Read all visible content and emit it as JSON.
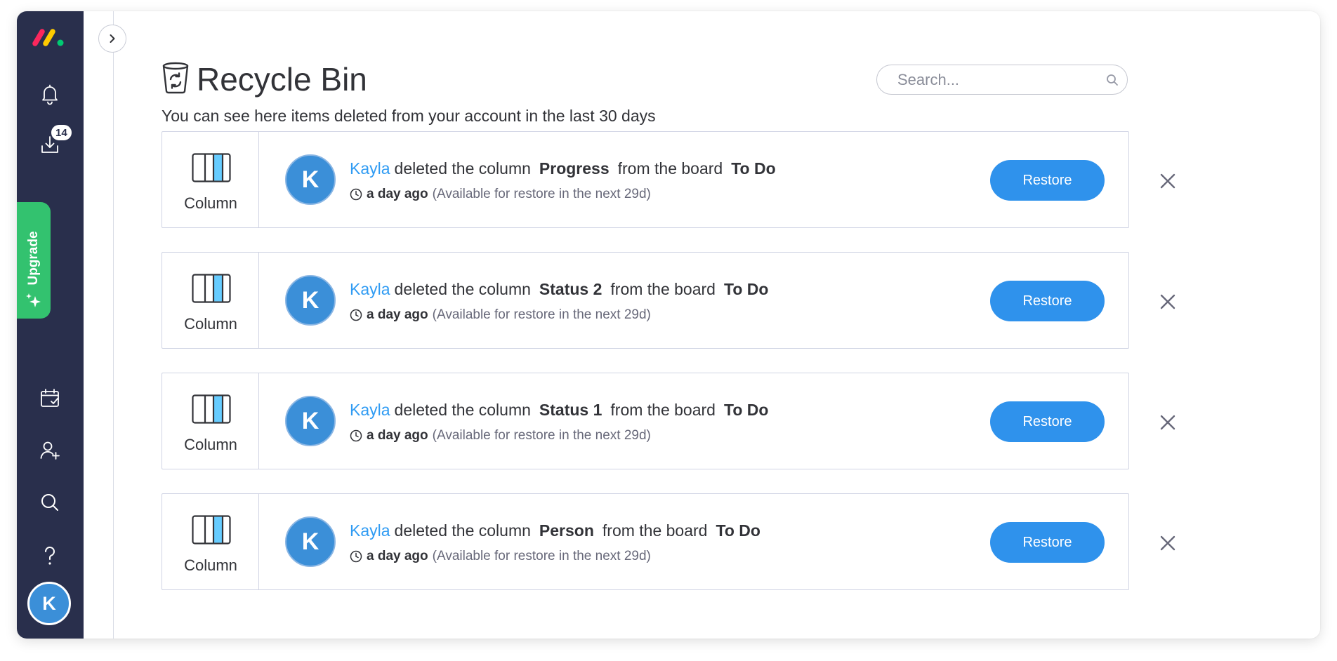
{
  "nav": {
    "notifications_badge": "14",
    "upgrade_label": "Upgrade",
    "avatar_initial": "K"
  },
  "header": {
    "title": "Recycle Bin",
    "subtitle": "You can see here items deleted from your account in the last 30 days"
  },
  "search": {
    "placeholder": "Search..."
  },
  "items": [
    {
      "type_label": "Column",
      "avatar_initial": "K",
      "user": "Kayla",
      "action": "deleted the column",
      "item_name": "Progress",
      "connector": "from the board",
      "board": "To Do",
      "time": "a day ago",
      "availability": "(Available for restore in the next 29d)",
      "restore_label": "Restore"
    },
    {
      "type_label": "Column",
      "avatar_initial": "K",
      "user": "Kayla",
      "action": "deleted the column",
      "item_name": "Status 2",
      "connector": "from the board",
      "board": "To Do",
      "time": "a day ago",
      "availability": "(Available for restore in the next 29d)",
      "restore_label": "Restore"
    },
    {
      "type_label": "Column",
      "avatar_initial": "K",
      "user": "Kayla",
      "action": "deleted the column",
      "item_name": "Status 1",
      "connector": "from the board",
      "board": "To Do",
      "time": "a day ago",
      "availability": "(Available for restore in the next 29d)",
      "restore_label": "Restore"
    },
    {
      "type_label": "Column",
      "avatar_initial": "K",
      "user": "Kayla",
      "action": "deleted the column",
      "item_name": "Person",
      "connector": "from the board",
      "board": "To Do",
      "time": "a day ago",
      "availability": "(Available for restore in the next 29d)",
      "restore_label": "Restore"
    }
  ],
  "colors": {
    "nav_bg": "#292f4c",
    "upgrade_green": "#33c26f",
    "primary_blue": "#2f92ec",
    "link_blue": "#2f9bf3",
    "logo_red": "#fb275d",
    "logo_yellow": "#ffcb00",
    "logo_green": "#00ca72"
  },
  "icons": {
    "logo": "monday-logo",
    "notifications": "bell-icon",
    "inbox": "inbox-download-icon",
    "upgrade": "sparkle-icon",
    "my_work": "calendar-check-icon",
    "invite": "add-person-icon",
    "search": "search-icon",
    "help": "question-icon",
    "expand": "chevron-right-icon",
    "recycle_bin": "recycle-bin-icon",
    "item_type": "column-icon",
    "time": "clock-icon",
    "dismiss": "close-icon"
  }
}
